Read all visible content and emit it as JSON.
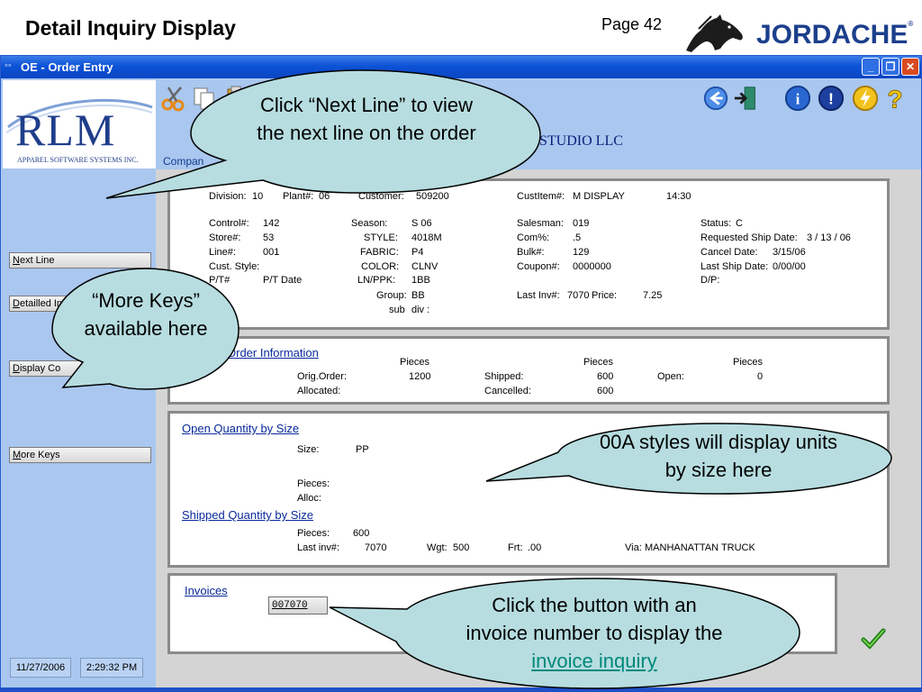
{
  "slide": {
    "title": "Detail Inquiry Display",
    "page_label": "Page 42",
    "brand": "JORDACHE",
    "brand_mark": "®"
  },
  "window": {
    "title": "OE - Order Entry",
    "minimize": "_",
    "restore": "❐",
    "close": "✕"
  },
  "logo": {
    "text": "RLM",
    "subtitle": "APPAREL SOFTWARE SYSTEMS INC."
  },
  "header": {
    "company_label": "Compan",
    "company_name": "STUDIO LLC"
  },
  "sidebar": {
    "buttons": [
      "Next Line",
      "Detailled Invoice Data",
      "Display Co",
      "More Keys"
    ],
    "date": "11/27/2006",
    "time": "2:29:32 PM"
  },
  "detail": {
    "division_label": "Division:",
    "division": "10",
    "plant_label": "Plant#:",
    "plant": "06",
    "customer_label": "Customer:",
    "customer": "509200",
    "custitem_label": "CustItem#:",
    "custitem": "M DISPLAY",
    "custitem_time": "14:30",
    "control_label": "Control#:",
    "control": "142",
    "store_label": "Store#:",
    "store": "53",
    "line_label": "Line#:",
    "line": "001",
    "cust_style_label": "Cust. Style:",
    "pt_label": "P/T#",
    "pt_date_label": "P/T Date",
    "season_label": "Season:",
    "season": "S  06",
    "style_label": "STYLE:",
    "style": "4018M",
    "fabric_label": "FABRIC:",
    "fabric": "P4",
    "color_label": "COLOR:",
    "color": "CLNV",
    "lnppk_label": "LN/PPK:",
    "lnppk": "1BB",
    "group_label": "Group:",
    "group": "BB",
    "subdiv_label": "sub",
    "subdiv": "div :",
    "salesman_label": "Salesman:",
    "salesman": "019",
    "com_label": "Com%:",
    "com": ".5",
    "bulk_label": "Bulk#:",
    "bulk": "129",
    "coupon_label": "Coupon#:",
    "coupon": "0000000",
    "lastinv_label": "Last Inv#:",
    "lastinv": "7070",
    "price_label": "Price:",
    "price": "7.25",
    "status_label": "Status:",
    "status": "C",
    "req_ship_label": "Requested Ship Date:",
    "req_ship": "3 / 13 / 06",
    "cancel_label": "Cancel Date:",
    "cancel": "3/15/06",
    "last_ship_label": "Last Ship Date:",
    "last_ship": "0/00/00",
    "dp_label": "D/P:"
  },
  "order_info": {
    "heading": "Order Information",
    "pieces_col1": "Pieces",
    "pieces_col2": "Pieces",
    "pieces_col3": "Pieces",
    "orig_label": "Orig.Order:",
    "orig": "1200",
    "allocated_label": "Allocated:",
    "shipped_label": "Shipped:",
    "shipped": "600",
    "cancelled_label": "Cancelled:",
    "cancelled": "600",
    "open_label": "Open:",
    "open": "0"
  },
  "open_qty": {
    "heading": "Open Quantity by Size",
    "size_label": "Size:",
    "size": "PP",
    "pieces_label": "Pieces:",
    "alloc_label": "Alloc:"
  },
  "shipped_qty": {
    "heading": "Shipped Quantity by Size",
    "pieces_label": "Pieces:",
    "pieces": "600",
    "lastinv_label": "Last inv#:",
    "lastinv": "7070",
    "wgt_label": "Wgt:",
    "wgt": "500",
    "frt_label": "Frt:",
    "frt": ".00",
    "via_label": "Via:",
    "via": "MANHANATTAN TRUCK"
  },
  "invoices": {
    "heading": "Invoices",
    "button": "007070"
  },
  "callouts": {
    "next_line": "Click “Next Line” to view the next line on the order",
    "more_keys": "“More Keys” available here",
    "styles": "00A styles will display units by size here",
    "invoice_pre": "Click the button with an invoice number to display the",
    "invoice_link": "invoice inquiry"
  },
  "colors": {
    "callout_fill": "#b7dde0",
    "titlebar": "#0c52d6",
    "link": "#00897b"
  },
  "icons": [
    "scissors-icon",
    "copy-icon",
    "paste-icon",
    "back-arrow-icon",
    "exit-door-icon",
    "info-icon",
    "alert-icon",
    "lightning-icon",
    "help-icon",
    "checkmark-icon",
    "horse-logo-icon"
  ]
}
